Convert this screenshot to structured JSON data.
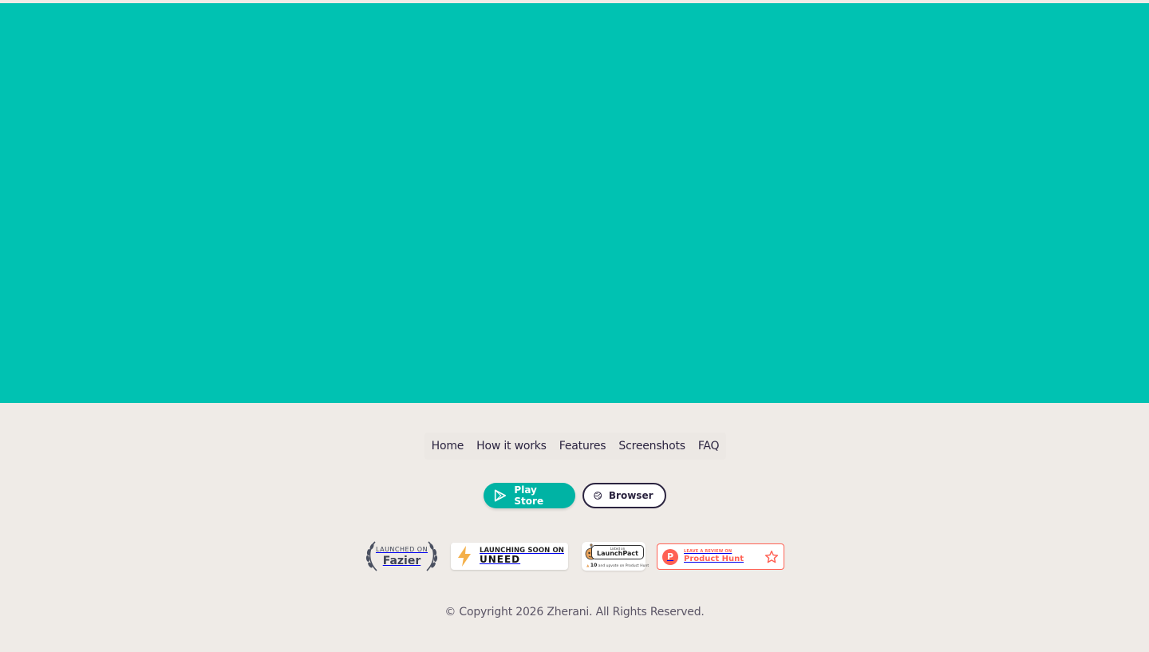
{
  "colors": {
    "hero_background": "#00c2b2",
    "footer_background": "#efebe7",
    "primary_button": "#00b3a4",
    "dark_text": "#2b2440",
    "product_hunt": "#ff6154"
  },
  "nav": {
    "items": [
      {
        "label": "Home"
      },
      {
        "label": "How it works"
      },
      {
        "label": "Features"
      },
      {
        "label": "Screenshots"
      },
      {
        "label": "FAQ"
      }
    ]
  },
  "buttons": {
    "play_store": {
      "label": "Play Store",
      "icon": "play-store-icon"
    },
    "browser": {
      "label": "Browser",
      "icon": "browser-globe-icon"
    }
  },
  "badges": {
    "fazier": {
      "top": "LAUNCHED ON",
      "name": "Fazier"
    },
    "uneed": {
      "top": "LAUNCHING SOON ON",
      "name": "UNEED"
    },
    "launchpact": {
      "small": "Listed on",
      "name": "LaunchPact",
      "rank": "10",
      "bottom": "and upvote on Product Hunt"
    },
    "product_hunt": {
      "top": "LEAVE A REVIEW ON",
      "name": "Product Hunt",
      "logo_letter": "P"
    }
  },
  "footer": {
    "copyright": "© Copyright 2026 Zherani. All Rights Reserved."
  }
}
